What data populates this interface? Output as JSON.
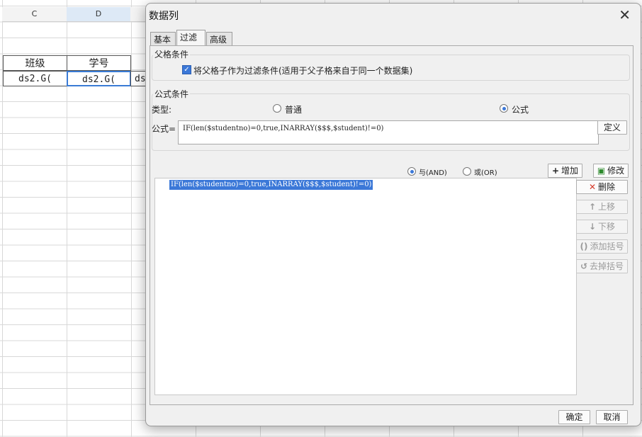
{
  "sheet": {
    "col_c": "C",
    "col_d": "D",
    "header_c": "班级",
    "header_d": "学号",
    "cell_c": "ds2.G(",
    "cell_d": "ds2.G(",
    "cell_e": "ds"
  },
  "dialog": {
    "title": "数据列",
    "close": "✕",
    "tabs": [
      "基本",
      "过滤",
      "高级"
    ],
    "parent_group_label": "父格条件",
    "parent_checkbox_label": "将父格子作为过滤条件(适用于父子格来自于同一个数据集)",
    "formula_group_label": "公式条件",
    "type_label": "类型:",
    "type_normal": "普通",
    "type_formula": "公式",
    "type_selected": "公式",
    "formula_label": "公式=",
    "formula_value": "IF(len($studentno)=0,true,INARRAY($$$,$student)!=0)",
    "define_button": "定义",
    "and_label": "与(AND)",
    "or_label": "或(OR)",
    "logic_selected": "与(AND)",
    "add_button": "增加",
    "modify_button": "修改",
    "conditions": [
      "IF(len($studentno)=0,true,INARRAY($$$,$student)!=0)"
    ],
    "delete_button": "删除",
    "up_button": "上移",
    "down_button": "下移",
    "add_bracket_button": "添加括号",
    "remove_bracket_button": "去掉括号",
    "ok_button": "确定",
    "cancel_button": "取消"
  }
}
